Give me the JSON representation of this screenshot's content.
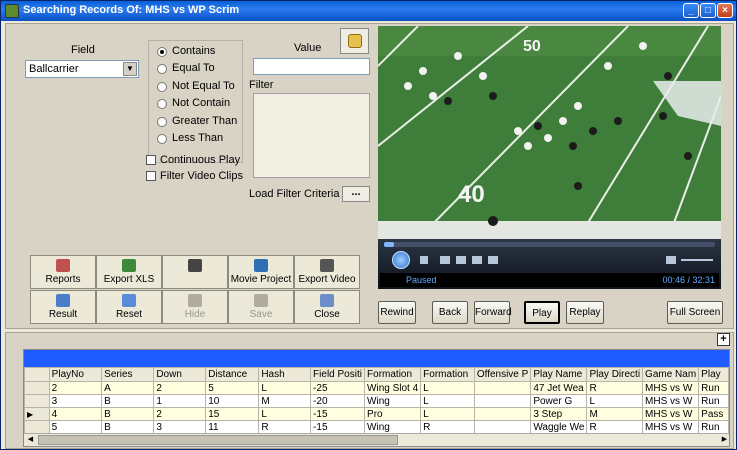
{
  "window": {
    "title": "Searching Records Of: MHS vs WP Scrim",
    "min_label": "_",
    "max_label": "□",
    "close_label": "×"
  },
  "search": {
    "field_label": "Field",
    "field_value": "Ballcarrier",
    "value_label": "Value",
    "filter_label": "Filter",
    "operators": [
      "Contains",
      "Equal To",
      "Not Equal To",
      "Not Contain",
      "Greater Than",
      "Less Than"
    ],
    "selected_operator": "Contains",
    "continuous_play_label": "Continuous Play",
    "filter_video_clips_label": "Filter Video Clips",
    "load_filter_label": "Load Filter Criteria",
    "load_filter_button": "..."
  },
  "toolbar": {
    "row1": [
      {
        "label": "Reports",
        "icon": "reports-icon",
        "color": "#c0504d"
      },
      {
        "label": "Export XLS",
        "icon": "export-xls-icon",
        "color": "#3f8a3a"
      },
      {
        "label": "",
        "icon": "runner-icon",
        "color": "#444444"
      },
      {
        "label": "Movie Project",
        "icon": "movie-project-icon",
        "color": "#2f6fb5"
      },
      {
        "label": "Export Video",
        "icon": "export-video-icon",
        "color": "#555555"
      }
    ],
    "row2": [
      {
        "label": "Result",
        "icon": "magnifier-icon",
        "color": "#4a7ec9",
        "enabled": true
      },
      {
        "label": "Reset",
        "icon": "reset-icon",
        "color": "#5a8bd8",
        "enabled": true
      },
      {
        "label": "Hide",
        "icon": "hide-icon",
        "color": "#b0aca0",
        "enabled": false
      },
      {
        "label": "Save",
        "icon": "save-icon",
        "color": "#b0aca0",
        "enabled": false
      },
      {
        "label": "Close",
        "icon": "close-window-icon",
        "color": "#6c8fc9",
        "enabled": true
      }
    ]
  },
  "player": {
    "status": "Paused",
    "time": "00:46 / 32:31",
    "progress": 0.03,
    "field_numbers": [
      "50",
      "40"
    ]
  },
  "video_buttons": [
    {
      "label": "Rewind",
      "selected": false
    },
    {
      "label": "Back",
      "selected": false
    },
    {
      "label": "Forward",
      "selected": false
    },
    {
      "label": "Play",
      "selected": true
    },
    {
      "label": "Replay",
      "selected": false
    },
    {
      "label": "Full Screen",
      "selected": false
    }
  ],
  "grid": {
    "plus_label": "+",
    "columns": [
      "PlayNo",
      "Series",
      "Down",
      "Distance",
      "Hash",
      "Field Positi",
      "Formation",
      "Formation",
      "Offensive P",
      "Play Name",
      "Play Directi",
      "Game Nam",
      "Play"
    ],
    "rows": [
      {
        "marker": "",
        "cells": [
          "2",
          "A",
          "2",
          "5",
          "L",
          "-25",
          "Wing Slot 4",
          "L",
          "",
          "47 Jet Wea",
          "R",
          "MHS vs W",
          "Run"
        ]
      },
      {
        "marker": "",
        "cells": [
          "3",
          "B",
          "1",
          "10",
          "M",
          "-20",
          "Wing",
          "L",
          "",
          "Power G",
          "L",
          "MHS vs W",
          "Run"
        ]
      },
      {
        "marker": "▶",
        "cells": [
          "4",
          "B",
          "2",
          "15",
          "L",
          "-15",
          "Pro",
          "L",
          "",
          "3 Step",
          "M",
          "MHS vs W",
          "Pass"
        ]
      },
      {
        "marker": "",
        "cells": [
          "5",
          "B",
          "3",
          "11",
          "R",
          "-15",
          "Wing",
          "R",
          "",
          "Waggle We",
          "R",
          "MHS vs W",
          "Run"
        ]
      }
    ]
  }
}
